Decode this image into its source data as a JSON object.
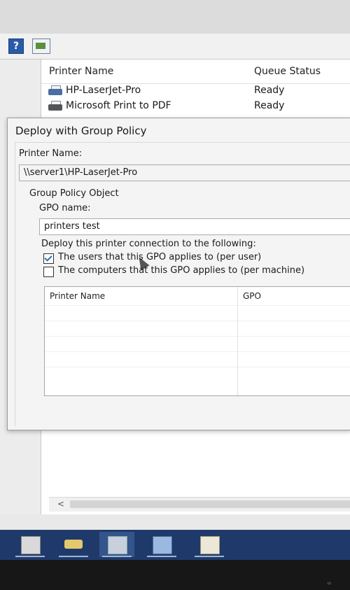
{
  "toolbar": {
    "help_icon": "help-icon",
    "console_icon": "console-view-icon"
  },
  "printer_list": {
    "columns": [
      "Printer Name",
      "Queue Status"
    ],
    "rows": [
      {
        "name": "HP-LaserJet-Pro",
        "status": "Ready",
        "icon": "network-printer-icon"
      },
      {
        "name": "Microsoft Print to PDF",
        "status": "Ready",
        "icon": "printer-icon"
      }
    ]
  },
  "dialog": {
    "title": "Deploy with Group Policy",
    "printer_name_label": "Printer Name:",
    "printer_name_value": "\\\\server1\\HP-LaserJet-Pro",
    "gpo_group_label": "Group Policy Object",
    "gpo_name_label": "GPO name:",
    "gpo_name_value": "printers test",
    "deploy_label": "Deploy this printer connection to the following:",
    "options": [
      {
        "label": "The users that this GPO applies to (per user)",
        "checked": true
      },
      {
        "label": "The computers that this GPO applies to (per machine)",
        "checked": false
      }
    ],
    "grid_columns": [
      "Printer Name",
      "GPO"
    ]
  },
  "scrollbar": {
    "left_arrow": "<"
  },
  "taskbar": {
    "apps": [
      {
        "icon": "server-manager-icon",
        "active": false
      },
      {
        "icon": "drive-icon",
        "active": false
      },
      {
        "icon": "tools-icon",
        "active": true
      },
      {
        "icon": "server-icon",
        "active": false
      },
      {
        "icon": "document-icon",
        "active": false
      }
    ]
  },
  "colors": {
    "taskbar": "#1f3a6a",
    "checkbox_accent": "#2f6fb1",
    "dialog_bg": "#f4f4f4"
  }
}
